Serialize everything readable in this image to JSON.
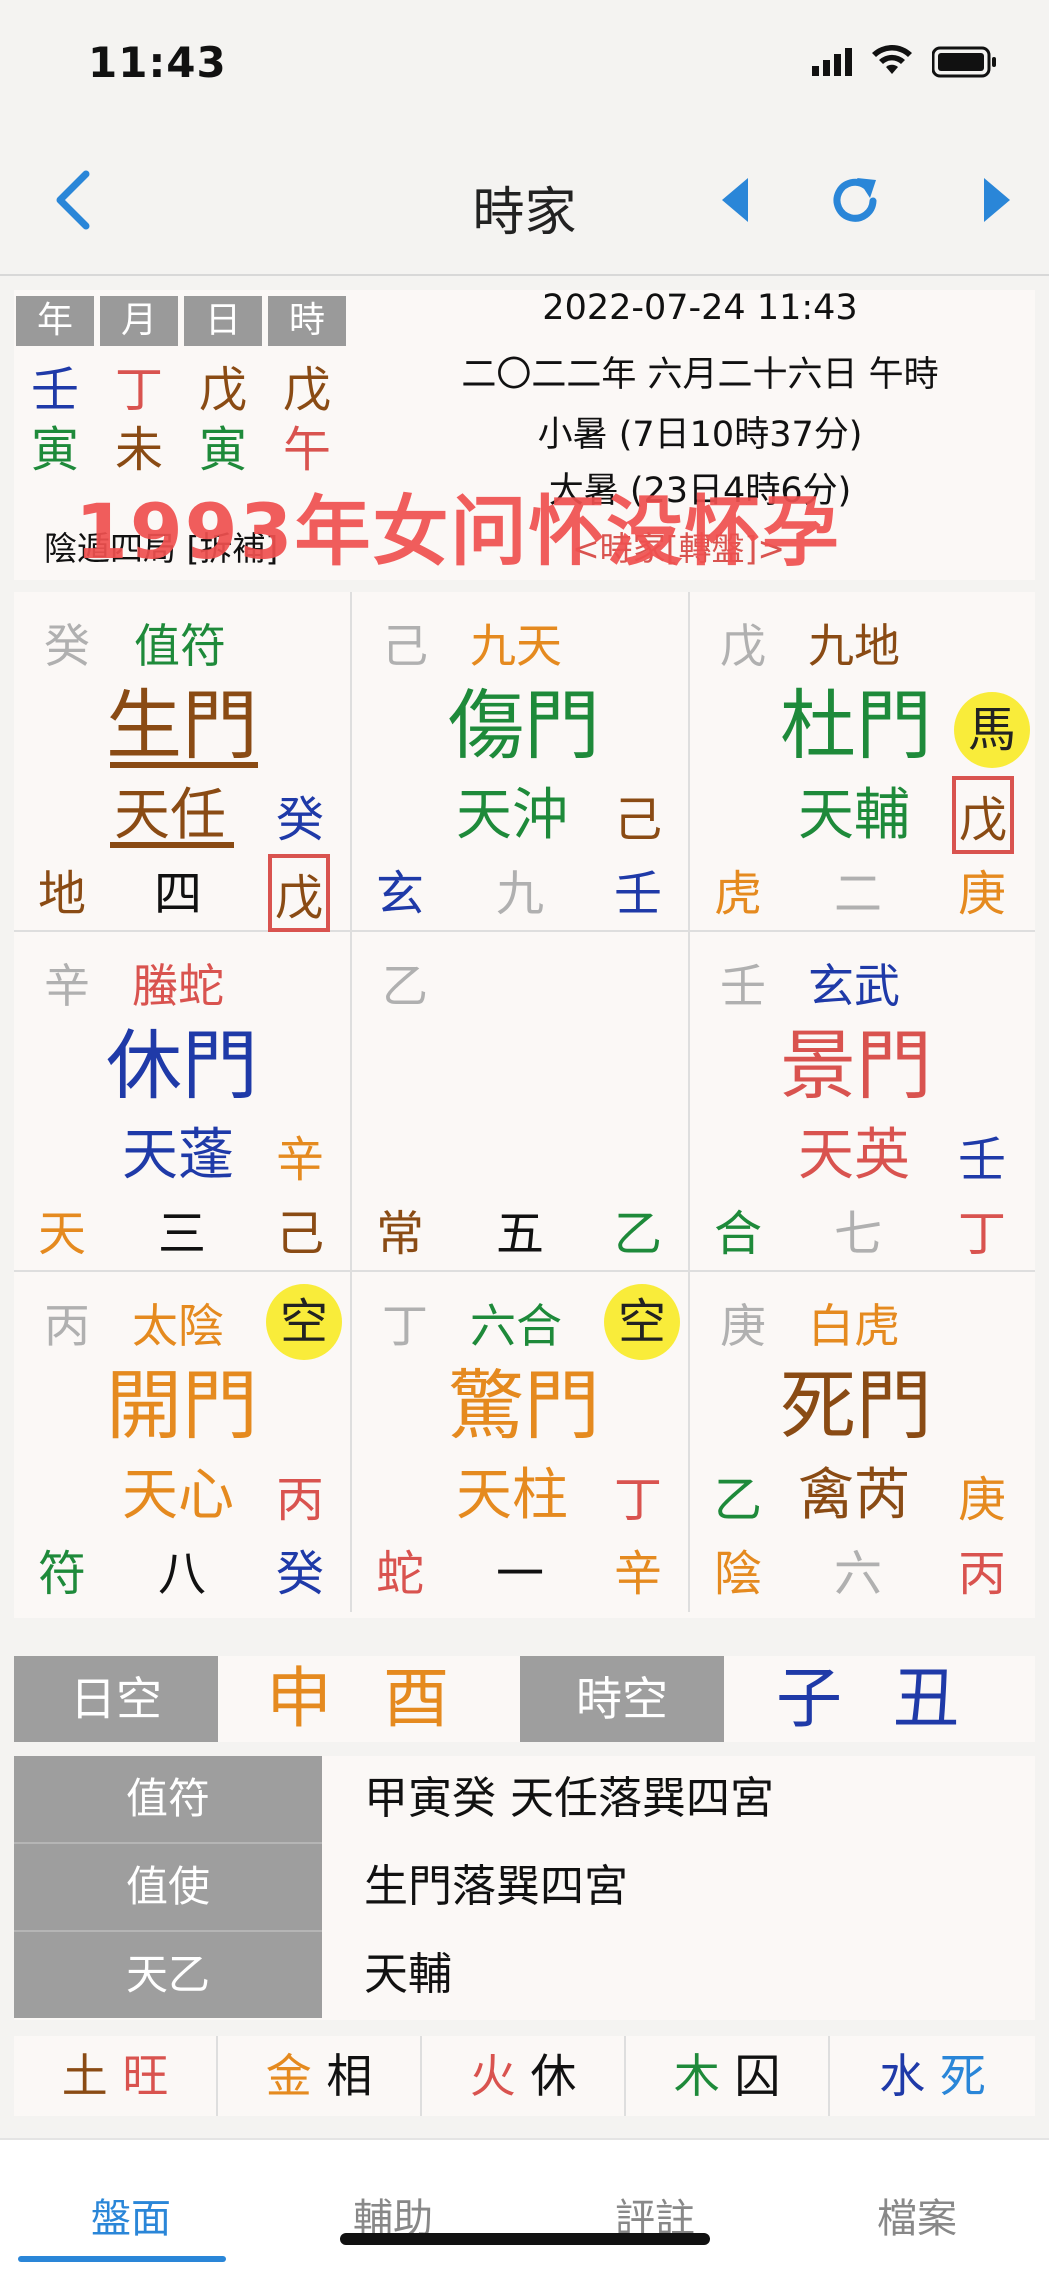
{
  "status": {
    "time": "11:43"
  },
  "nav": {
    "title": "時家",
    "back_icon": "chevron-left-icon",
    "prev_icon": "triangle-left-icon",
    "refresh_icon": "refresh-icon",
    "next_icon": "triangle-right-icon"
  },
  "header": {
    "pillar_labels": [
      "年",
      "月",
      "日",
      "時"
    ],
    "stems": [
      "壬",
      "丁",
      "戊",
      "戊"
    ],
    "branches": [
      "寅",
      "未",
      "寅",
      "午"
    ],
    "datetime": "2022-07-24 11:43",
    "lunar": "二〇二二年 六月二十六日 午時",
    "term1": "小暑 (7日10時37分)",
    "term2": "大暑 (23日4時6分)",
    "ju": "陰遁四局 [拆補]",
    "zhuanpan": "<時家[轉盤]>",
    "overlay": "1993年女问怀没怀孕"
  },
  "palaces": [
    {
      "tl": "癸",
      "god": "值符",
      "gate": "生門",
      "star": "天任",
      "rs": "癸",
      "bl": "地",
      "num": "四",
      "br": "戊"
    },
    {
      "tl": "己",
      "god": "九天",
      "gate": "傷門",
      "star": "天沖",
      "rs": "己",
      "bl": "玄",
      "num": "九",
      "br": "壬"
    },
    {
      "tl": "戊",
      "god": "九地",
      "gate": "杜門",
      "badge": "馬",
      "star": "天輔",
      "rs": "戊",
      "bl": "虎",
      "num": "二",
      "br": "庚"
    },
    {
      "tl": "辛",
      "god": "螣蛇",
      "gate": "休門",
      "star": "天蓬",
      "rs": "辛",
      "bl": "天",
      "num": "三",
      "br": "己"
    },
    {
      "tl": "乙",
      "bl": "常",
      "num": "五",
      "br": "乙"
    },
    {
      "tl": "壬",
      "god": "玄武",
      "gate": "景門",
      "star": "天英",
      "rs": "壬",
      "bl": "合",
      "num": "七",
      "br": "丁"
    },
    {
      "tl": "丙",
      "god": "太陰",
      "badge": "空",
      "gate": "開門",
      "star": "天心",
      "rs": "丙",
      "bl": "符",
      "num": "八",
      "br": "癸"
    },
    {
      "tl": "丁",
      "god": "六合",
      "badge": "空",
      "gate": "驚門",
      "star": "天柱",
      "rs": "丁",
      "bl": "蛇",
      "num": "一",
      "br": "辛"
    },
    {
      "tl": "庚",
      "god": "白虎",
      "gate": "死門",
      "ls": "乙",
      "star": "禽芮",
      "rs": "庚",
      "bl": "陰",
      "num": "六",
      "br": "丙"
    }
  ],
  "kong": {
    "day_label": "日空",
    "day_value": "申 酉",
    "hour_label": "時空",
    "hour_value": "子 丑"
  },
  "table": [
    {
      "label": "值符",
      "value": "甲寅癸  天任落巽四宮"
    },
    {
      "label": "值使",
      "value": "生門落巽四宮"
    },
    {
      "label": "天乙",
      "value": "天輔"
    }
  ],
  "wuxing": [
    {
      "el": "土",
      "state": "旺"
    },
    {
      "el": "金",
      "state": "相"
    },
    {
      "el": "火",
      "state": "休"
    },
    {
      "el": "木",
      "state": "囚"
    },
    {
      "el": "水",
      "state": "死"
    }
  ],
  "tabs": [
    "盤面",
    "輔助",
    "評註",
    "檔案"
  ],
  "colors": {
    "accent": "#2a86d8",
    "red": "#d9534f",
    "green": "#1e8a3a",
    "blue": "#1f3aa8",
    "orange": "#e58a1f",
    "brown": "#8a4b14",
    "gray": "#b0b0b0"
  }
}
